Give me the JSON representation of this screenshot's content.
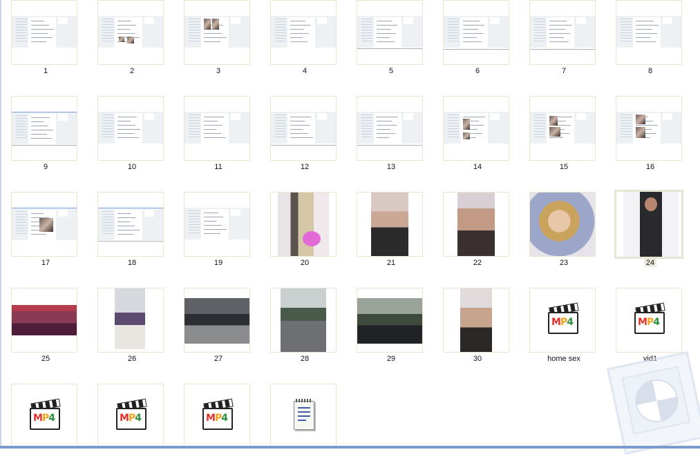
{
  "window": {
    "view": "Large icons",
    "selected_item": "24"
  },
  "items": [
    {
      "label": "1",
      "type": "screenshot"
    },
    {
      "label": "2",
      "type": "screenshot"
    },
    {
      "label": "3",
      "type": "screenshot"
    },
    {
      "label": "4",
      "type": "screenshot"
    },
    {
      "label": "5",
      "type": "screenshot"
    },
    {
      "label": "6",
      "type": "screenshot"
    },
    {
      "label": "7",
      "type": "screenshot"
    },
    {
      "label": "8",
      "type": "screenshot"
    },
    {
      "label": "9",
      "type": "screenshot"
    },
    {
      "label": "10",
      "type": "screenshot"
    },
    {
      "label": "11",
      "type": "screenshot"
    },
    {
      "label": "12",
      "type": "screenshot"
    },
    {
      "label": "13",
      "type": "screenshot"
    },
    {
      "label": "14",
      "type": "screenshot"
    },
    {
      "label": "15",
      "type": "screenshot"
    },
    {
      "label": "16",
      "type": "screenshot"
    },
    {
      "label": "17",
      "type": "screenshot"
    },
    {
      "label": "18",
      "type": "screenshot"
    },
    {
      "label": "19",
      "type": "screenshot"
    },
    {
      "label": "20",
      "type": "photo"
    },
    {
      "label": "21",
      "type": "photo"
    },
    {
      "label": "22",
      "type": "photo"
    },
    {
      "label": "23",
      "type": "photo"
    },
    {
      "label": "24",
      "type": "photo"
    },
    {
      "label": "25",
      "type": "photo"
    },
    {
      "label": "26",
      "type": "photo"
    },
    {
      "label": "27",
      "type": "photo"
    },
    {
      "label": "28",
      "type": "photo"
    },
    {
      "label": "29",
      "type": "photo"
    },
    {
      "label": "30",
      "type": "photo"
    },
    {
      "label": "home sex",
      "type": "mp4"
    },
    {
      "label": "vid1",
      "type": "mp4"
    },
    {
      "label": "",
      "type": "mp4"
    },
    {
      "label": "",
      "type": "mp4"
    },
    {
      "label": "",
      "type": "mp4"
    },
    {
      "label": "",
      "type": "text"
    }
  ],
  "icons": {
    "video": "mp4-file-icon",
    "text": "text-file-icon",
    "watermark": "app-watermark-icon"
  },
  "mp4_badge": {
    "m": "M",
    "p": "P",
    "n": "4"
  },
  "colors": {
    "accent": "#7a9acb",
    "frame": "#ece4cc",
    "selection": "#eeeae0"
  }
}
